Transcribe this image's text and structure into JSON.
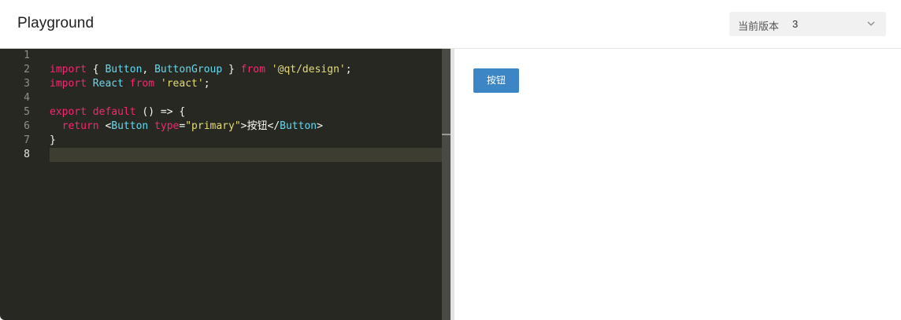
{
  "header": {
    "title": "Playground",
    "version_select": {
      "label": "当前版本",
      "value": "3",
      "icon": "chevron-down-icon"
    }
  },
  "editor": {
    "line_numbers": [
      "1",
      "2",
      "3",
      "4",
      "5",
      "6",
      "7",
      "8"
    ],
    "active_line": "8",
    "lines": [
      [],
      [
        {
          "t": "import",
          "c": "kw"
        },
        {
          "t": " { ",
          "c": "pl"
        },
        {
          "t": "Button",
          "c": "id"
        },
        {
          "t": ", ",
          "c": "pl"
        },
        {
          "t": "ButtonGroup",
          "c": "id"
        },
        {
          "t": " } ",
          "c": "pl"
        },
        {
          "t": "from",
          "c": "kw"
        },
        {
          "t": " ",
          "c": "pl"
        },
        {
          "t": "'@qt/design'",
          "c": "str"
        },
        {
          "t": ";",
          "c": "pl"
        }
      ],
      [
        {
          "t": "import",
          "c": "kw"
        },
        {
          "t": " ",
          "c": "pl"
        },
        {
          "t": "React",
          "c": "id"
        },
        {
          "t": " ",
          "c": "pl"
        },
        {
          "t": "from",
          "c": "kw"
        },
        {
          "t": " ",
          "c": "pl"
        },
        {
          "t": "'react'",
          "c": "str"
        },
        {
          "t": ";",
          "c": "pl"
        }
      ],
      [],
      [
        {
          "t": "export",
          "c": "kw"
        },
        {
          "t": " ",
          "c": "pl"
        },
        {
          "t": "default",
          "c": "kw"
        },
        {
          "t": " () => {",
          "c": "pl"
        }
      ],
      [
        {
          "t": "  ",
          "c": "pl"
        },
        {
          "t": "return",
          "c": "kw"
        },
        {
          "t": " <",
          "c": "pl"
        },
        {
          "t": "Button",
          "c": "id"
        },
        {
          "t": " ",
          "c": "pl"
        },
        {
          "t": "type",
          "c": "kw"
        },
        {
          "t": "=",
          "c": "pl"
        },
        {
          "t": "\"primary\"",
          "c": "str"
        },
        {
          "t": ">按钮</",
          "c": "pl"
        },
        {
          "t": "Button",
          "c": "id"
        },
        {
          "t": ">",
          "c": "pl"
        }
      ],
      [
        {
          "t": "}",
          "c": "pl"
        }
      ],
      []
    ],
    "colors": {
      "background": "#272822",
      "keyword": "#f92672",
      "identifier": "#66d9ef",
      "string": "#e6db74",
      "plain": "#f8f8f2"
    }
  },
  "preview": {
    "button_label": "按钮",
    "button_color": "#3d86c6"
  }
}
